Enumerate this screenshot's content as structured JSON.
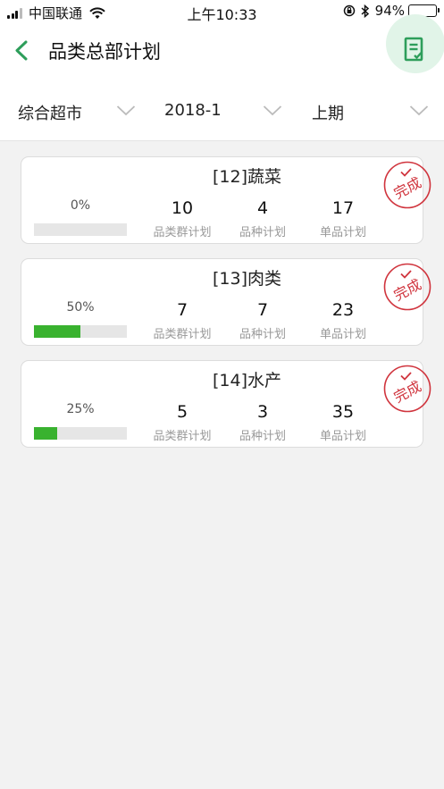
{
  "status_bar": {
    "carrier": "中国联通",
    "time": "上午10:33",
    "battery": "94%",
    "battery_level": 0.94
  },
  "header": {
    "title": "品类总部计划"
  },
  "filters": [
    {
      "label": "综合超市"
    },
    {
      "label": "2018-1"
    },
    {
      "label": "上期"
    }
  ],
  "cards": [
    {
      "title": "[12]蔬菜",
      "percent": "0%",
      "progress": 0,
      "metrics": [
        {
          "value": "10",
          "caption": "品类群计划"
        },
        {
          "value": "4",
          "caption": "品种计划"
        },
        {
          "value": "17",
          "caption": "单品计划"
        }
      ],
      "stamp": "完成"
    },
    {
      "title": "[13]肉类",
      "percent": "50%",
      "progress": 0.5,
      "metrics": [
        {
          "value": "7",
          "caption": "品类群计划"
        },
        {
          "value": "7",
          "caption": "品种计划"
        },
        {
          "value": "23",
          "caption": "单品计划"
        }
      ],
      "stamp": "完成"
    },
    {
      "title": "[14]水产",
      "percent": "25%",
      "progress": 0.25,
      "metrics": [
        {
          "value": "5",
          "caption": "品类群计划"
        },
        {
          "value": "3",
          "caption": "品种计划"
        },
        {
          "value": "35",
          "caption": "单品计划"
        }
      ],
      "stamp": "完成"
    }
  ],
  "colors": {
    "accent": "#2e9e5b",
    "progress": "#39b22f",
    "stamp": "#d0343d"
  },
  "icons": {
    "back": "chevron-left-icon",
    "action": "document-check-icon",
    "dropdown": "chevron-down-icon",
    "stamp": "complete-stamp-icon"
  }
}
